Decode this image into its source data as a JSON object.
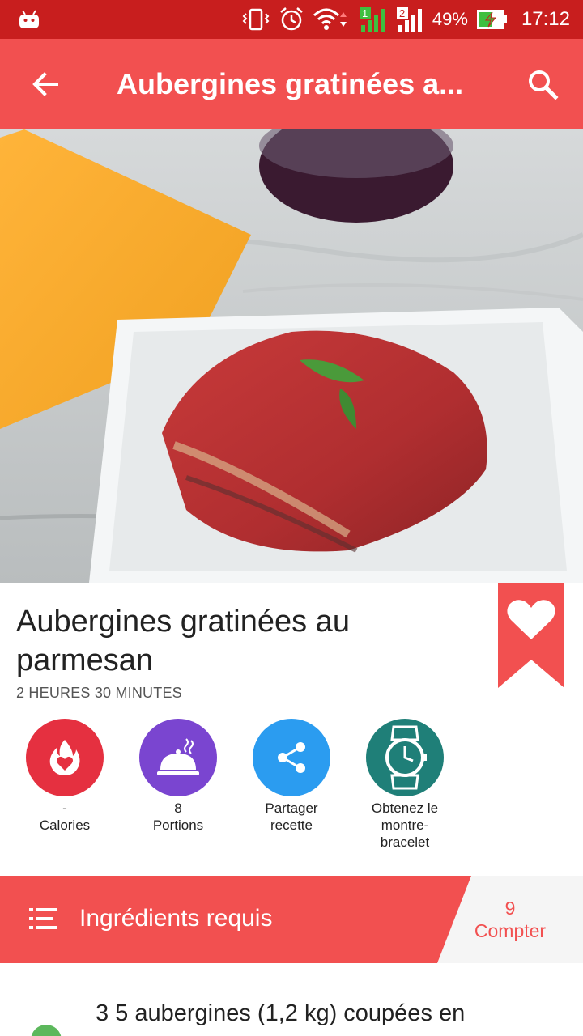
{
  "status_bar": {
    "battery": "49%",
    "time": "17:12",
    "sim1": "1",
    "sim2": "2",
    "icons": [
      "android-icon",
      "vibrate-icon",
      "alarm-icon",
      "wifi-icon",
      "signal-1-icon",
      "signal-2-icon",
      "battery-charging-icon"
    ]
  },
  "app_bar": {
    "title": "Aubergines gratinées a...",
    "back_icon": "arrow-back-icon",
    "search_icon": "search-icon",
    "color": "#f25050"
  },
  "recipe": {
    "title": "Aubergines gratinées au parmesan",
    "time": "2 HEURES 30 MINUTES",
    "favorite_icon": "heart-bookmark-icon"
  },
  "actions": [
    {
      "value": "-",
      "label": "Calories",
      "icon": "calories-flame-icon",
      "color": "#e53040"
    },
    {
      "value": "8",
      "label": "Portions",
      "icon": "serving-dish-icon",
      "color": "#7a45d0"
    },
    {
      "label_line1": "Partager",
      "label_line2": "recette",
      "icon": "share-icon",
      "color": "#2b9cf0"
    },
    {
      "label_line1": "Obtenez le",
      "label_line2": "montre-",
      "label_line3": "bracelet",
      "icon": "watch-icon",
      "color": "#1f7f78"
    }
  ],
  "ingredients": {
    "header": "Ingrédients requis",
    "count": "9",
    "count_label": "Compter",
    "first_item": "3  5 aubergines (1,2 kg) coupées en"
  }
}
